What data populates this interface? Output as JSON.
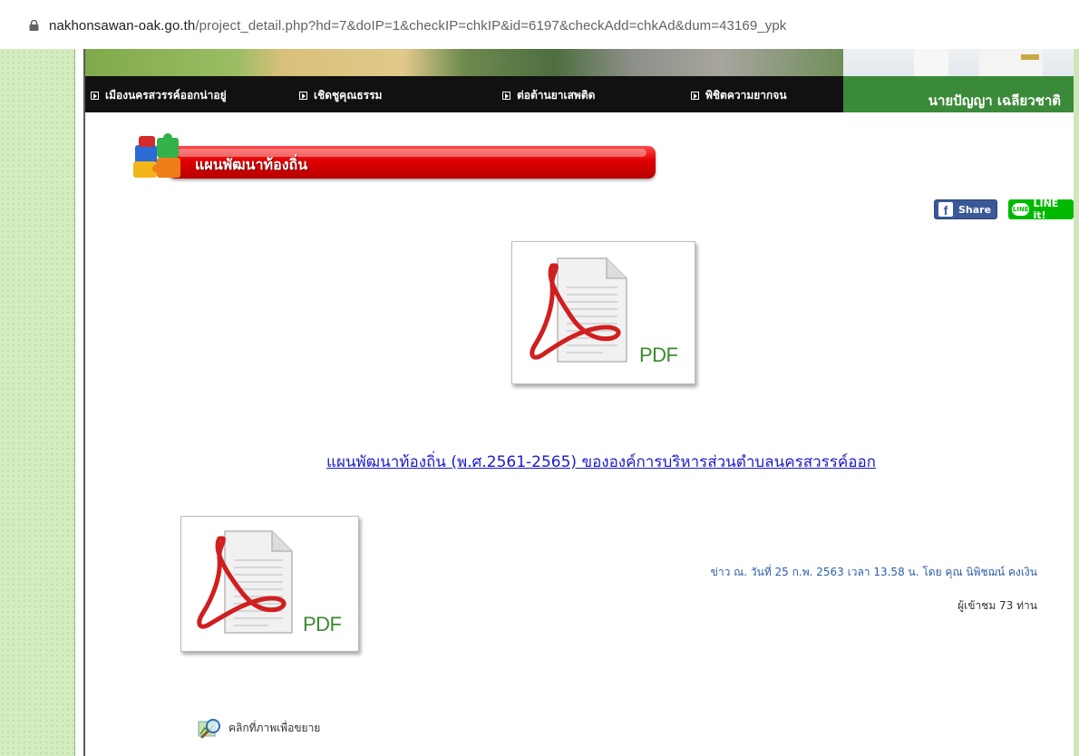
{
  "browser": {
    "url_host": "nakhonsawan-oak.go.th",
    "url_path": "/project_detail.php?hd=7&doIP=1&checkIP=chkIP&id=6197&checkAdd=chkAd&dum=43169_ypk"
  },
  "nav": {
    "items": [
      {
        "label": "เมืองนครสวรรค์ออกน่าอยู่"
      },
      {
        "label": "เชิดชูคุณธรรม"
      },
      {
        "label": "ต่อต้านยาเสพติด"
      },
      {
        "label": "พิชิตความยากจน"
      }
    ],
    "person_name": "นายปัญญา เฉลียวชาติ"
  },
  "section": {
    "title": "แผนพัฒนาท้องถิ่น"
  },
  "social": {
    "share_label": "Share",
    "facebook_glyph": "f",
    "line_badge": "LINE",
    "line_label": "LINE it!"
  },
  "document": {
    "pdf_label": "PDF",
    "link_text": "แผนพัฒนาท้องถิ่น (พ.ศ.2561-2565) ขององค์การบริหารส่วนตำบลนครสวรรค์ออก"
  },
  "meta": {
    "news_line": "ข่าว ณ. วันที่ 25 ก.พ. 2563 เวลา 13.58 น. โดย คุณ นิพิชฌน์ คงเงิน",
    "views_line": "ผู้เข้าชม 73 ท่าน"
  },
  "zoom_hint": "คลิกที่ภาพเพื่อขยาย",
  "colors": {
    "nav_bg": "#111111",
    "name_box": "#3b8a3a",
    "header_red": "#e00000",
    "link_blue": "#1a1acc",
    "meta_blue": "#2b5ea8",
    "facebook": "#3b5998",
    "line": "#00b900"
  },
  "icons": [
    "lock-icon",
    "puzzle-icon",
    "pdf-icon",
    "magnifier-icon",
    "facebook-icon",
    "line-icon"
  ]
}
